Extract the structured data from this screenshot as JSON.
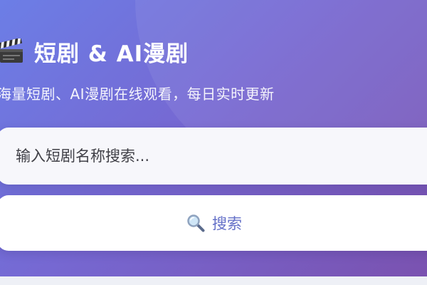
{
  "header": {
    "title": "短剧 & AI漫剧",
    "title_icon": "clapperboard-icon",
    "subtitle": "海量短剧、AI漫剧在线观看，每日实时更新"
  },
  "search": {
    "placeholder": "输入短剧名称搜索...",
    "value": "",
    "button_label": "搜索",
    "button_icon": "magnifier-icon"
  },
  "colors": {
    "gradient_start": "#6c7ee6",
    "gradient_end": "#7a52b0",
    "button_text": "#6470c8"
  }
}
